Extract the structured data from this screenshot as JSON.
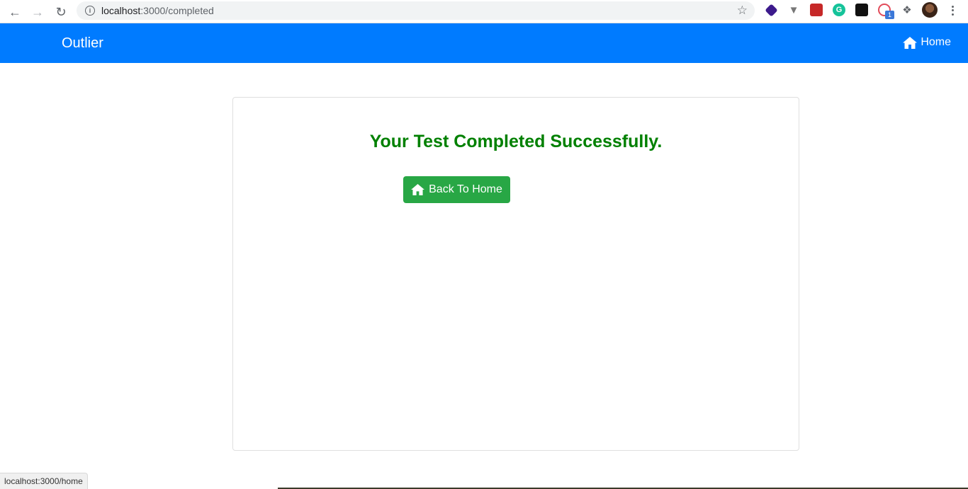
{
  "browser": {
    "url_host": "localhost",
    "url_path": ":3000/completed",
    "status_url": "localhost:3000/home",
    "extension_badge": "1"
  },
  "navbar": {
    "brand": "Outlier",
    "home_label": "Home"
  },
  "main": {
    "message": "Your Test Completed Successfully.",
    "back_button_label": "Back To Home"
  },
  "colors": {
    "navbar": "#007bff",
    "success_text": "#008000",
    "button": "#28a745"
  }
}
